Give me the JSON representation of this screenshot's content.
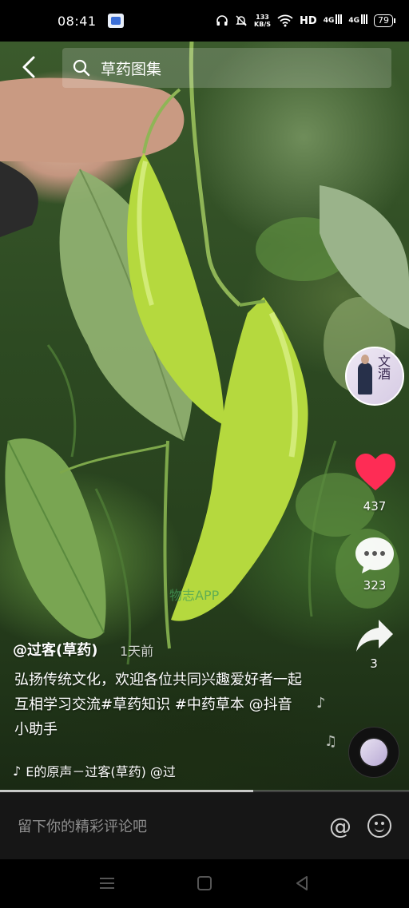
{
  "status_bar": {
    "time": "08:41",
    "net_speed_value": "133",
    "net_speed_unit": "KB/S",
    "network": "HD",
    "signal1": "4G",
    "signal2": "4G",
    "battery": "79"
  },
  "header": {
    "search_text": "草药图集"
  },
  "rail": {
    "likes": "437",
    "comments": "323",
    "shares": "3",
    "like_color": "#fe2c55"
  },
  "caption": {
    "author": "@过客(草药)",
    "time_ago": "1天前",
    "description": "弘扬传统文化，欢迎各位共同兴趣爱好者一起互相学习交流#草药知识 #中药草本 @抖音小助手",
    "music": "E的原声－过客(草药)   @过"
  },
  "overlay": {
    "watermark": "物志APP"
  },
  "playback": {
    "progress_percent": 62
  },
  "comment_bar": {
    "placeholder": "留下你的精彩评论吧"
  }
}
